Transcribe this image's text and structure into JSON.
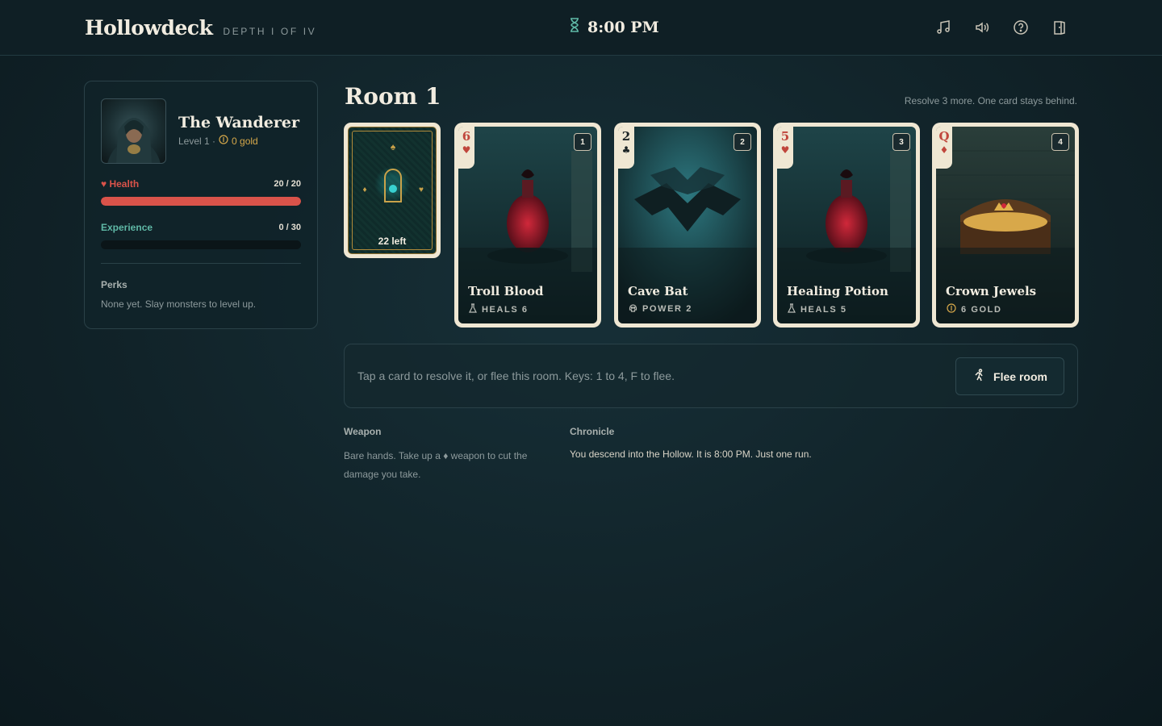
{
  "topbar": {
    "brand": "Hollowdeck",
    "depth": "DEPTH I OF IV",
    "clock": "8:00 PM",
    "icons": [
      "music-icon",
      "volume-icon",
      "help-icon",
      "exit-icon"
    ]
  },
  "hero": {
    "name": "The Wanderer",
    "level": "Level 1 ·",
    "gold": "0 gold",
    "health_label": "Health",
    "health_value": "20 / 20",
    "health_fraction": 1.0,
    "xp_label": "Experience",
    "xp_value": "0 / 30",
    "xp_fraction": 0.0,
    "perks_title": "Perks",
    "perks_text": "None yet. Slay monsters to level up."
  },
  "room": {
    "title": "Room 1",
    "hint": "Resolve 3 more. One card stays behind.",
    "deck_count": "22 left",
    "cards": [
      {
        "rank": "6",
        "suit": "♥",
        "suit_color": "#c0463c",
        "badge": "1",
        "name": "Troll Blood",
        "stat_icon": "flask-icon",
        "stat": "HEALS 6",
        "art": "potion"
      },
      {
        "rank": "2",
        "suit": "♣",
        "suit_color": "#1b2426",
        "badge": "2",
        "name": "Cave Bat",
        "stat_icon": "skull-icon",
        "stat": "POWER 2",
        "art": "bat"
      },
      {
        "rank": "5",
        "suit": "♥",
        "suit_color": "#c0463c",
        "badge": "3",
        "name": "Healing Potion",
        "stat_icon": "flask-icon",
        "stat": "HEALS 5",
        "art": "potion"
      },
      {
        "rank": "Q",
        "suit": "♦",
        "suit_color": "#c0463c",
        "badge": "4",
        "name": "Crown Jewels",
        "stat_icon": "coin-icon",
        "stat": "6 GOLD",
        "art": "treasure"
      }
    ]
  },
  "actions": {
    "instruction": "Tap a card to resolve it, or flee this room. Keys: 1 to 4, F to flee.",
    "flee_label": "Flee room"
  },
  "weapon": {
    "title": "Weapon",
    "text": "Bare hands. Take up a ♦ weapon to cut the damage you take."
  },
  "chronicle": {
    "title": "Chronicle",
    "entry": "You descend into the Hollow. It is 8:00 PM. Just one run."
  },
  "colors": {
    "health": "#d9534a",
    "experience": "#5fb8a6",
    "gold": "#d6a84a",
    "card_border": "#efe7d3"
  }
}
